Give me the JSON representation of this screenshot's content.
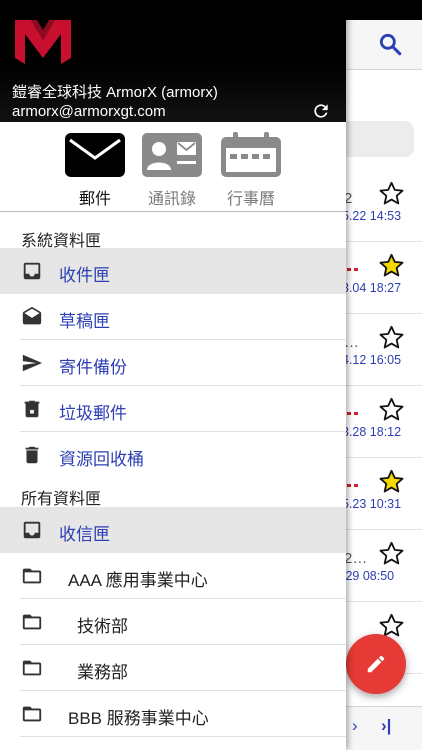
{
  "account": {
    "name": "鎧睿全球科技 ArmorX (armorx)",
    "email": "armorx@armorxgt.com"
  },
  "modules": [
    {
      "label": "郵件",
      "icon": "mail-icon",
      "active": true
    },
    {
      "label": "通訊錄",
      "icon": "contacts-icon",
      "active": false
    },
    {
      "label": "行事曆",
      "icon": "calendar-icon",
      "active": false
    }
  ],
  "system_folders": {
    "title": "系統資料匣",
    "items": [
      {
        "label": "收件匣",
        "icon": "inbox-icon",
        "selected": true
      },
      {
        "label": "草稿匣",
        "icon": "drafts-icon",
        "selected": false
      },
      {
        "label": "寄件備份",
        "icon": "sent-icon",
        "selected": false
      },
      {
        "label": "垃圾郵件",
        "icon": "spam-icon",
        "selected": false
      },
      {
        "label": "資源回收桶",
        "icon": "trash-icon",
        "selected": false
      }
    ]
  },
  "all_folders": {
    "title": "所有資料匣",
    "items": [
      {
        "label": "收信匣",
        "icon": "inbox-icon",
        "selected": true
      },
      {
        "label": "AAA 應用事業中心",
        "icon": "folder-icon",
        "selected": false
      },
      {
        "label": "技術部",
        "icon": "folder-icon",
        "selected": false
      },
      {
        "label": "業務部",
        "icon": "folder-icon",
        "selected": false
      },
      {
        "label": "BBB 服務事業中心",
        "icon": "folder-icon",
        "selected": false
      }
    ]
  },
  "background_list": {
    "rows": [
      {
        "snippet": "2",
        "date": "5.22 14:53",
        "starred": false
      },
      {
        "snippet": "",
        "date": "3.04 18:27",
        "starred": true
      },
      {
        "snippet": "…",
        "date": "4.12 16:05",
        "starred": false
      },
      {
        "snippet": "",
        "date": "3.28 18:12",
        "starred": false
      },
      {
        "snippet": "",
        "date": "5.23 10:31",
        "starred": true
      },
      {
        "snippet": "2…",
        "date": ".29 08:50",
        "starred": false
      },
      {
        "snippet": "",
        "date": "",
        "starred": false
      }
    ],
    "pager": {
      "next": "›",
      "last": "›|"
    }
  },
  "colors": {
    "accent_blue": "#2c3fb4",
    "fab_red": "#e53a35",
    "star_yellow": "#f5d800",
    "selected_row": "#e6e6e6"
  }
}
